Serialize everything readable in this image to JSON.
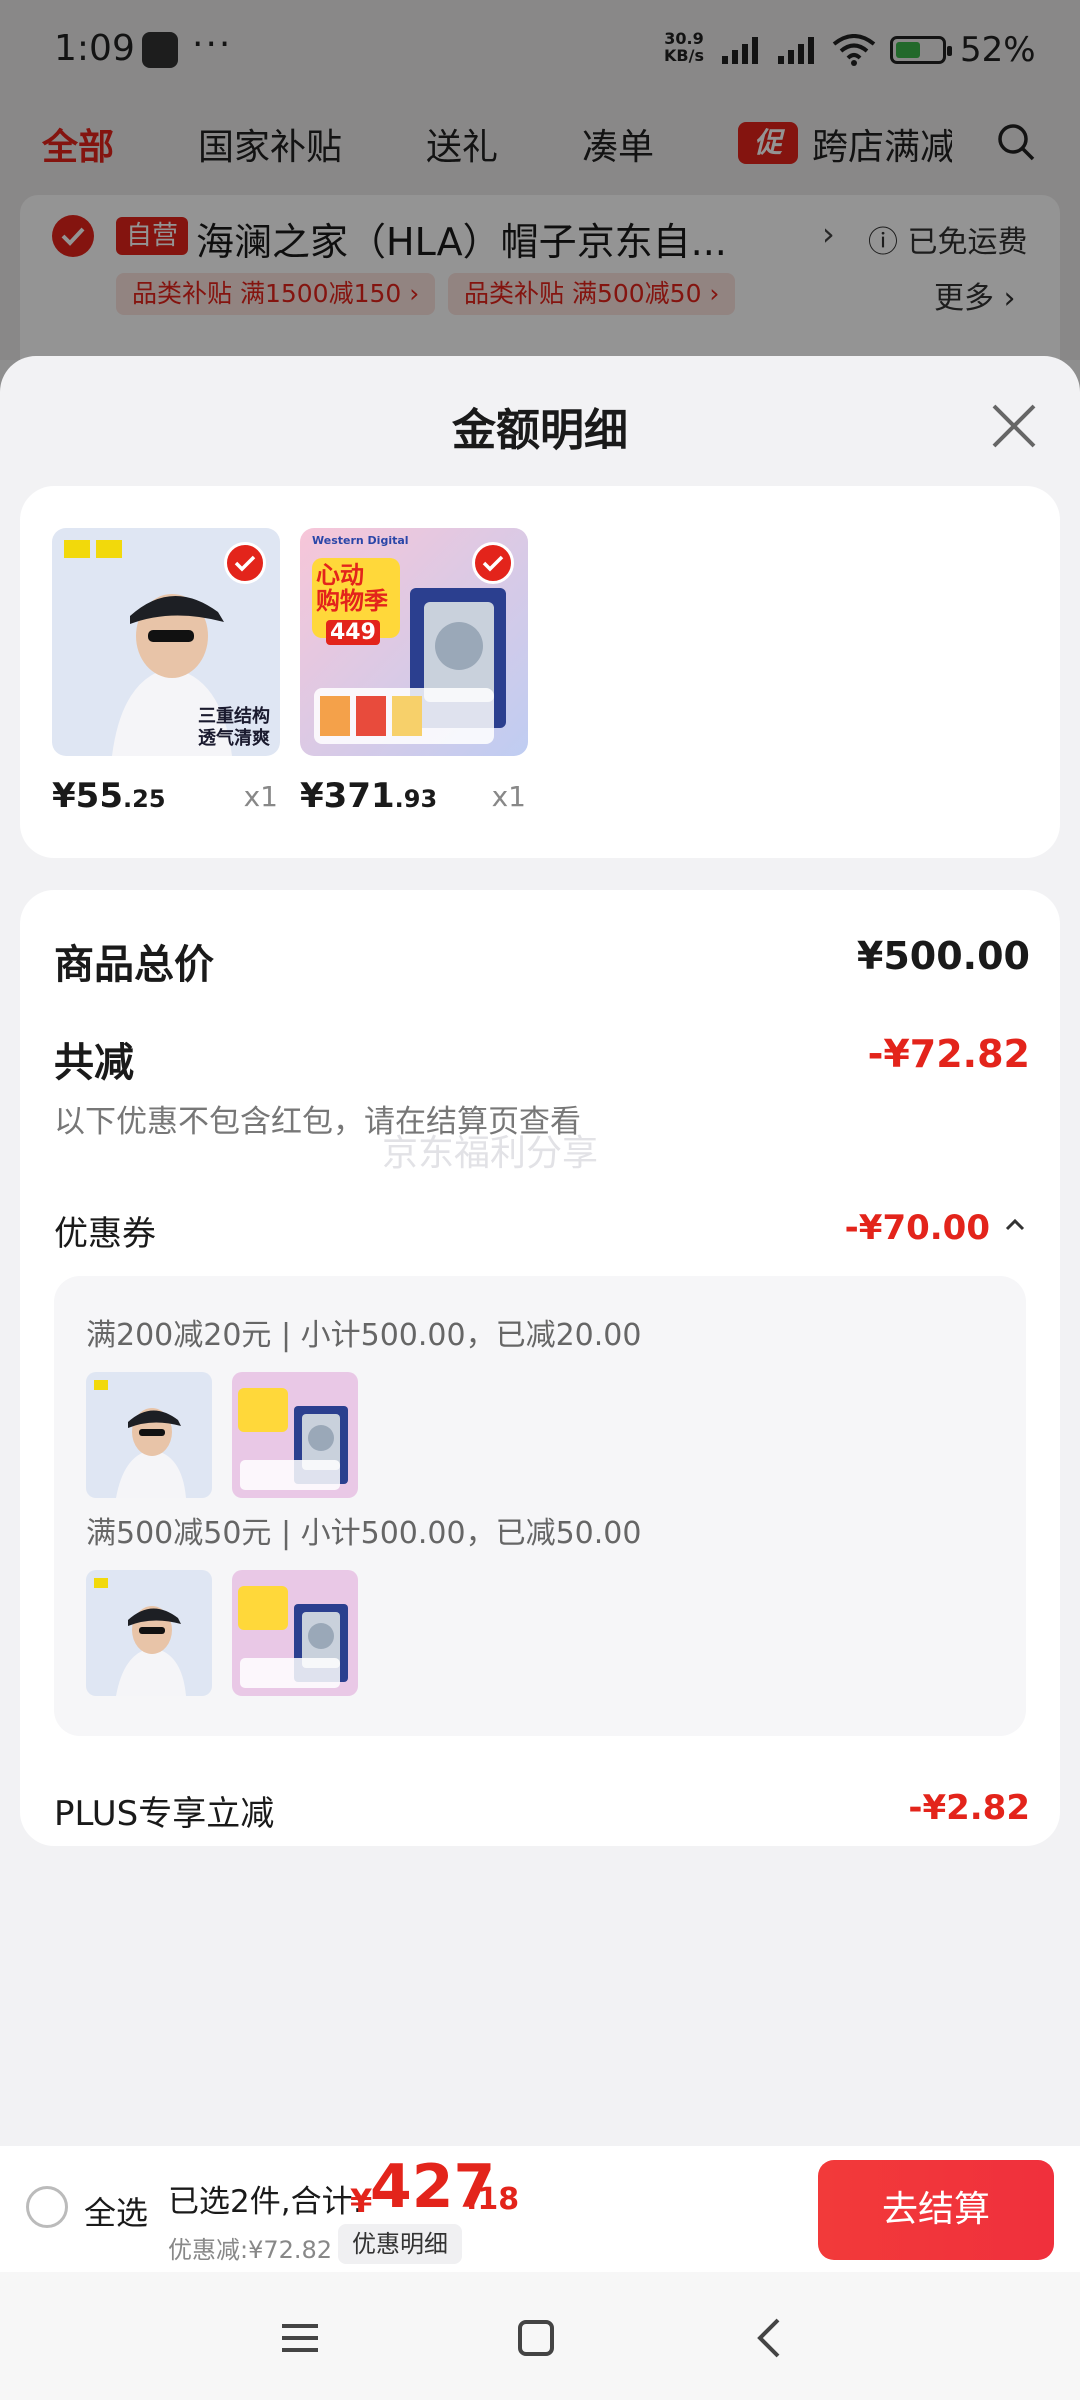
{
  "status_bar": {
    "time": "1:09",
    "dots": "···",
    "net_speed": "30.9",
    "net_unit": "KB/s",
    "battery": "52%"
  },
  "top_nav": {
    "tabs": [
      {
        "label": "全部",
        "active": true
      },
      {
        "label": "国家补贴",
        "active": false
      },
      {
        "label": "送礼",
        "active": false
      },
      {
        "label": "凑单",
        "active": false
      }
    ],
    "promo_badge": "促",
    "promo_label": "跨店满减"
  },
  "store": {
    "badge": "自营",
    "name": "海澜之家（HLA）帽子京东自...",
    "shipping": "已免运费",
    "subsidies": [
      "品类补贴 满1500减150 ›",
      "品类补贴 满500减50 ›"
    ],
    "more": "更多 ›"
  },
  "sheet": {
    "title": "金额明细",
    "products": [
      {
        "name": "cap",
        "price_yen": "¥",
        "price_int": "55",
        "price_dec": ".25",
        "qty": "x1",
        "img_text": "三重结构\n透气清爽"
      },
      {
        "name": "hdd",
        "price_yen": "¥",
        "price_int": "371",
        "price_dec": ".93",
        "qty": "x1",
        "img_text": "心动\n购物季",
        "brand": "Western Digital",
        "price_tag": "449"
      }
    ],
    "total_label": "商品总价",
    "total_value": "¥500.00",
    "reduce_label": "共减",
    "reduce_value": "-¥72.82",
    "note": "以下优惠不包含红包，请在结算页查看",
    "watermark": "京东福利分享",
    "coupon_label": "优惠券",
    "coupon_value": "-¥70.00",
    "coupon_lines": [
      "满200减20元 | 小计500.00，已减20.00",
      "满500减50元 | 小计500.00，已减50.00"
    ],
    "plus_label": "PLUS专享立减",
    "plus_value": "-¥2.82"
  },
  "bottom_bar": {
    "select_all": "全选",
    "selected_text": "已选2件,合计:",
    "total_yen": "¥",
    "total_int": "427",
    "total_dec": ".18",
    "discount": "优惠减:¥72.82",
    "detail_button": "优惠明细",
    "checkout_button": "去结算"
  },
  "colors": {
    "accent": "#e3241b",
    "sheet_bg": "#f2f2f4"
  }
}
